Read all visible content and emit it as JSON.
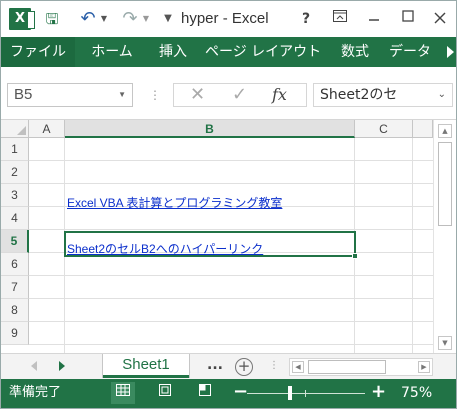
{
  "titlebar": {
    "app_icon": "X",
    "title": "hyper - Excel",
    "help": "?",
    "icons": {
      "save": "save-icon",
      "undo": "undo-icon",
      "redo": "redo-icon",
      "ribbon_options": "ribbon-display-options-icon",
      "minimize": "minimize-icon",
      "maximize": "maximize-icon",
      "close": "close-icon"
    }
  },
  "ribbon": {
    "tabs": [
      {
        "label": "ファイル"
      },
      {
        "label": "ホーム"
      },
      {
        "label": "挿入"
      },
      {
        "label": "ページ レイアウト"
      },
      {
        "label": "数式"
      },
      {
        "label": "データ"
      }
    ],
    "accent_color": "#217346"
  },
  "formula_bar": {
    "name_box": "B5",
    "fx": "fx",
    "formula": "Sheet2のセ"
  },
  "grid": {
    "columns": [
      "A",
      "B",
      "C"
    ],
    "selected_column": "B",
    "rows": [
      "1",
      "2",
      "3",
      "4",
      "5",
      "6",
      "7",
      "8",
      "9"
    ],
    "selected_row": "5",
    "cells": {
      "B3": "Excel VBA 表計算とプログラミング教室",
      "B5": "Sheet2のセルB2へのハイパーリンク"
    },
    "link_color": "#0b2fcc"
  },
  "sheet_tabs": {
    "active": "Sheet1",
    "more": "...",
    "add": "+"
  },
  "status_bar": {
    "status": "準備完了",
    "zoom_minus": "−",
    "zoom_plus": "+",
    "zoom_level": "75%",
    "zoom_value": 0.75
  }
}
